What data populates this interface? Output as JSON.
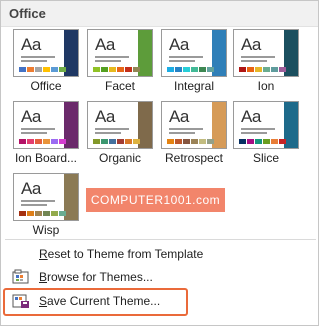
{
  "header": {
    "title": "Office"
  },
  "themes": [
    {
      "name": "Office",
      "aa": "Aa",
      "accent": "#1f3864",
      "swatches": [
        "#4472c4",
        "#ed7d31",
        "#a5a5a5",
        "#ffc000",
        "#5b9bd5",
        "#70ad47"
      ]
    },
    {
      "name": "Facet",
      "aa": "Aa",
      "accent": "#5d9c3a",
      "swatches": [
        "#90c226",
        "#54a021",
        "#e6b91e",
        "#e76618",
        "#c42f1a",
        "#918655"
      ]
    },
    {
      "name": "Integral",
      "aa": "Aa",
      "accent": "#2f7fb8",
      "swatches": [
        "#1cade4",
        "#2683c6",
        "#27ced7",
        "#42ba97",
        "#3e8853",
        "#62a39f"
      ]
    },
    {
      "name": "Ion",
      "aa": "Aa",
      "accent": "#1b4f5f",
      "swatches": [
        "#b01513",
        "#ea6312",
        "#e6b729",
        "#6aac90",
        "#5f9c9d",
        "#9e5e9b"
      ]
    },
    {
      "name": "Ion Boardroom",
      "label": "Ion Board...",
      "aa": "Aa",
      "accent": "#6b2a6b",
      "swatches": [
        "#b31166",
        "#e33d6f",
        "#e45f3c",
        "#e9943a",
        "#9b6bf2",
        "#d53dd0"
      ]
    },
    {
      "name": "Organic",
      "aa": "Aa",
      "accent": "#7f6a4b",
      "swatches": [
        "#83992a",
        "#3c9770",
        "#44709d",
        "#a23c33",
        "#d97828",
        "#deb340"
      ]
    },
    {
      "name": "Retrospect",
      "aa": "Aa",
      "accent": "#d69b58",
      "swatches": [
        "#e48312",
        "#bd582c",
        "#865640",
        "#9b8357",
        "#c2bc80",
        "#94a088"
      ]
    },
    {
      "name": "Slice",
      "aa": "Aa",
      "accent": "#1e6a8a",
      "swatches": [
        "#052f61",
        "#a50e82",
        "#14967c",
        "#6a9e1f",
        "#e87d37",
        "#c62324"
      ]
    },
    {
      "name": "Wisp",
      "aa": "Aa",
      "accent": "#8b7a55",
      "swatches": [
        "#a53010",
        "#de7e18",
        "#9f8351",
        "#728653",
        "#92aa4c",
        "#6aac91"
      ]
    }
  ],
  "watermark": "COMPUTER1001.com",
  "menu": {
    "reset": {
      "label": "Reset to Theme from Template",
      "key": "R"
    },
    "browse": {
      "label": "Browse for Themes...",
      "key": "B"
    },
    "save": {
      "label": "Save Current Theme...",
      "key": "S"
    }
  },
  "colors": {
    "highlight": "#ea6a3a",
    "watermark_bg": "#f2856b"
  }
}
